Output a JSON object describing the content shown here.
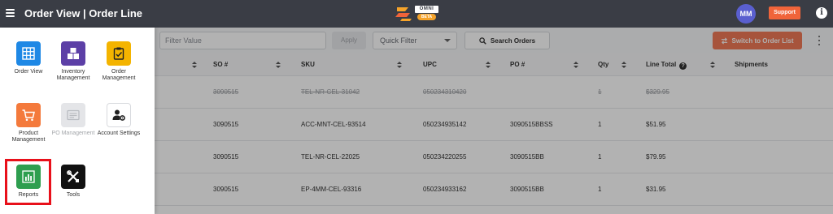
{
  "header": {
    "title": "Order View | Order Line",
    "logo_word": "OMNI",
    "logo_badge": "BETA",
    "avatar_initials": "MM",
    "support_label": "Support",
    "info_glyph": "i"
  },
  "toolbar": {
    "filter_placeholder": "Filter Value",
    "apply_label": "Apply",
    "quick_filter_label": "Quick Filter",
    "search_orders_label": "Search Orders",
    "switch_label": "Switch to Order List"
  },
  "table": {
    "columns": [
      "SO #",
      "SKU",
      "UPC",
      "PO #",
      "Qty",
      "Line Total",
      "Shipments"
    ],
    "help_glyph": "?",
    "rows": [
      {
        "so": "3090515",
        "sku": "TEL-NR-CEL-31042",
        "upc": "050234310420",
        "po": "",
        "qty": "1",
        "total": "$329.95",
        "shipments": "",
        "cancelled": true
      },
      {
        "so": "3090515",
        "sku": "ACC-MNT-CEL-93514",
        "upc": "050234935142",
        "po": "3090515BBSS",
        "qty": "1",
        "total": "$51.95",
        "shipments": "",
        "cancelled": false
      },
      {
        "so": "3090515",
        "sku": "TEL-NR-CEL-22025",
        "upc": "050234220255",
        "po": "3090515BB",
        "qty": "1",
        "total": "$79.95",
        "shipments": "",
        "cancelled": false
      },
      {
        "so": "3090515",
        "sku": "EP-4MM-CEL-93316",
        "upc": "050234933162",
        "po": "3090515BB",
        "qty": "1",
        "total": "$31.95",
        "shipments": "",
        "cancelled": false
      }
    ]
  },
  "side_menu": {
    "items": [
      {
        "label": "Order View",
        "icon": "grid-table-icon",
        "color": "#1e88e5",
        "enabled": true
      },
      {
        "label": "Inventory Management",
        "icon": "boxes-icon",
        "color": "#5c3fa6",
        "enabled": true
      },
      {
        "label": "Order Management",
        "icon": "clipboard-check-icon",
        "color": "#f4b400",
        "enabled": true
      },
      {
        "label": "Product Management",
        "icon": "cart-icon",
        "color": "#f47a3c",
        "enabled": true
      },
      {
        "label": "PO Management",
        "icon": "receipt-icon",
        "color": "#e4e5e8",
        "enabled": false
      },
      {
        "label": "Account Settings",
        "icon": "user-gear-icon",
        "color": "#ffffff",
        "enabled": true
      },
      {
        "label": "Reports",
        "icon": "bar-chart-icon",
        "color": "#2e9e4f",
        "enabled": true
      },
      {
        "label": "Tools",
        "icon": "tools-icon",
        "color": "#111111",
        "enabled": true
      }
    ]
  },
  "colors": {
    "header_bg": "#3a3d45",
    "accent_orange": "#f0643a",
    "highlight_red": "#e8101a"
  }
}
